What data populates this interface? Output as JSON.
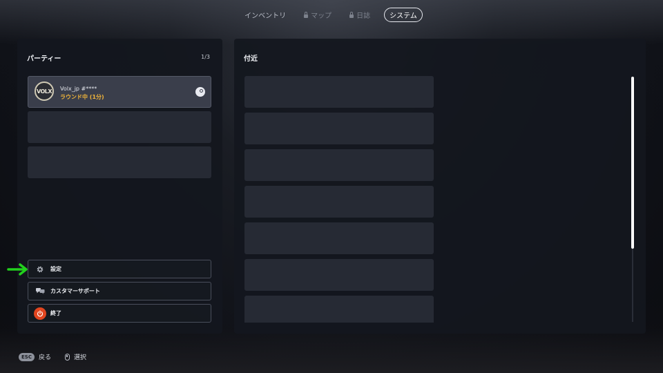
{
  "tabs": [
    {
      "label": "インベントリ",
      "locked": false,
      "active": false
    },
    {
      "label": "マップ",
      "locked": true,
      "active": false
    },
    {
      "label": "日誌",
      "locked": true,
      "active": false
    },
    {
      "label": "システム",
      "locked": false,
      "active": true
    }
  ],
  "party": {
    "title": "パーティー",
    "count": "1/3",
    "member": {
      "avatar_text": "VOLX",
      "name": "Volx_jp #****",
      "status": "ラウンド中 (1分)",
      "platform_icon": "steam-icon"
    }
  },
  "menu": {
    "settings_label": "設定",
    "support_label": "カスタマーサポート",
    "quit_label": "終了"
  },
  "nearby": {
    "title": "付近"
  },
  "footer": {
    "back_key": "ESC",
    "back_label": "戻る",
    "select_label": "選択"
  },
  "colors": {
    "accent_status": "#f0b43a",
    "quit_red": "#e2451f",
    "arrow_green": "#22d11d"
  }
}
